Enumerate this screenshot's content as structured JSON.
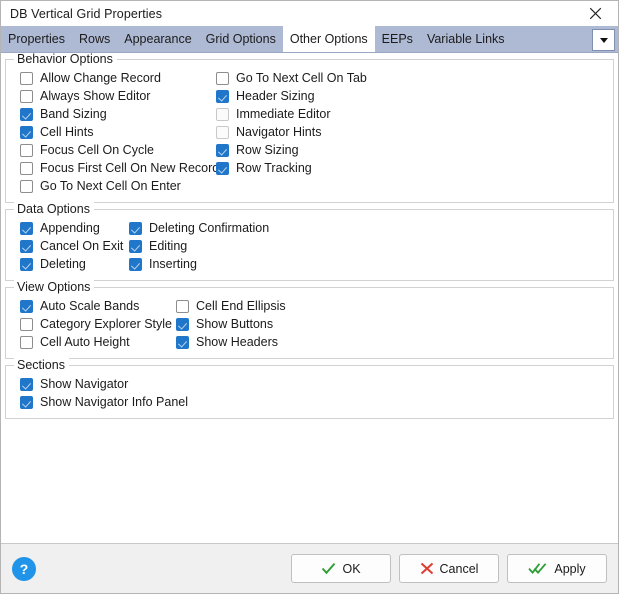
{
  "window": {
    "title": "DB Vertical Grid Properties",
    "close_icon": "close-icon"
  },
  "tabs": {
    "items": [
      {
        "label": "Properties",
        "active": false
      },
      {
        "label": "Rows",
        "active": false
      },
      {
        "label": "Appearance",
        "active": false
      },
      {
        "label": "Grid Options",
        "active": false
      },
      {
        "label": "Other Options",
        "active": true
      },
      {
        "label": "EEPs",
        "active": false
      },
      {
        "label": "Variable Links",
        "active": false
      }
    ],
    "overflow_icon": "chevron-down-icon"
  },
  "groups": [
    {
      "title": "Behavior Options",
      "columns": [
        [
          {
            "label": "Allow Change Record",
            "checked": false,
            "dim": false
          },
          {
            "label": "Always Show Editor",
            "checked": false,
            "dim": false
          },
          {
            "label": "Band Sizing",
            "checked": true,
            "dim": false
          },
          {
            "label": "Cell Hints",
            "checked": true,
            "dim": false
          },
          {
            "label": "Focus Cell On Cycle",
            "checked": false,
            "dim": false
          },
          {
            "label": "Focus First Cell On New Record",
            "checked": false,
            "dim": false
          },
          {
            "label": "Go To Next Cell On Enter",
            "checked": false,
            "dim": false
          }
        ],
        [
          {
            "label": "Go To Next Cell On Tab",
            "checked": false,
            "dim": false
          },
          {
            "label": "Header Sizing",
            "checked": true,
            "dim": false
          },
          {
            "label": "Immediate Editor",
            "checked": false,
            "dim": true
          },
          {
            "label": "Navigator Hints",
            "checked": false,
            "dim": true
          },
          {
            "label": "Row Sizing",
            "checked": true,
            "dim": false
          },
          {
            "label": "Row Tracking",
            "checked": true,
            "dim": false
          }
        ]
      ]
    },
    {
      "title": "Data Options",
      "columns": [
        [
          {
            "label": "Appending",
            "checked": true,
            "dim": false
          },
          {
            "label": "Cancel On Exit",
            "checked": true,
            "dim": false
          },
          {
            "label": "Deleting",
            "checked": true,
            "dim": false
          }
        ],
        [
          {
            "label": "Deleting Confirmation",
            "checked": true,
            "dim": false
          },
          {
            "label": "Editing",
            "checked": true,
            "dim": false
          },
          {
            "label": "Inserting",
            "checked": true,
            "dim": false
          }
        ]
      ]
    },
    {
      "title": "View Options",
      "columns": [
        [
          {
            "label": "Auto Scale Bands",
            "checked": true,
            "dim": false
          },
          {
            "label": "Category Explorer Style",
            "checked": false,
            "dim": false
          },
          {
            "label": "Cell Auto Height",
            "checked": false,
            "dim": false
          }
        ],
        [
          {
            "label": "Cell End Ellipsis",
            "checked": false,
            "dim": false
          },
          {
            "label": "Show Buttons",
            "checked": true,
            "dim": false
          },
          {
            "label": "Show Headers",
            "checked": true,
            "dim": false
          }
        ]
      ]
    },
    {
      "title": "Sections",
      "columns": [
        [
          {
            "label": "Show Navigator",
            "checked": true,
            "dim": false
          },
          {
            "label": "Show Navigator Info Panel",
            "checked": true,
            "dim": false
          }
        ]
      ]
    }
  ],
  "footer": {
    "help_label": "?",
    "buttons": [
      {
        "label": "OK",
        "icon": "check-icon",
        "color": "#2e9e34"
      },
      {
        "label": "Cancel",
        "icon": "cross-icon",
        "color": "#e03c31"
      },
      {
        "label": "Apply",
        "icon": "double-check-icon",
        "color": "#2e9e34"
      }
    ]
  },
  "colors": {
    "tabstrip": "#aebad4",
    "checkbox_checked": "#1a6fc4",
    "help_blue": "#2094e8",
    "footer_bg": "#f0f0f0"
  }
}
